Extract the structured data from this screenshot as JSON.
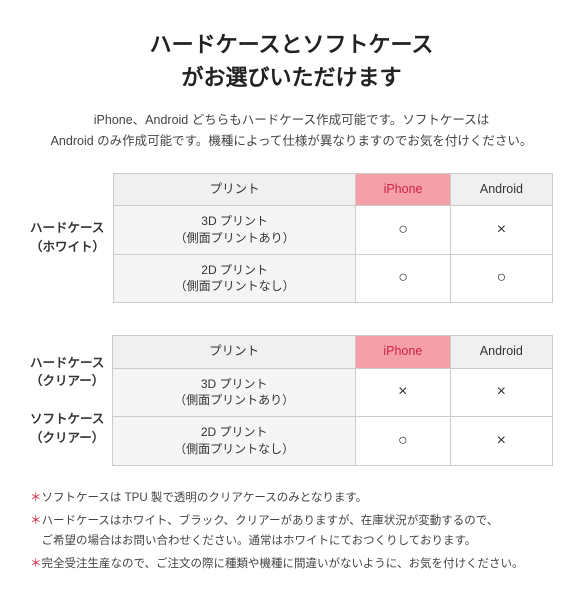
{
  "title": {
    "line1": "ハードケースとソフトケース",
    "line2": "がお選びいただけます"
  },
  "description": "iPhone、Android どちらもハードケース作成可能です。ソフトケースは\nAndroid のみ作成可能です。機種によって仕様が異なりますのでお気を付けください。",
  "table1": {
    "rowHeader": [
      "ハードケース",
      "（ホワイト）"
    ],
    "columns": [
      "プリント",
      "iPhone",
      "Android"
    ],
    "rows": [
      {
        "print": [
          "3D プリント",
          "（側面プリントあり）"
        ],
        "iphone": "○",
        "android": "×"
      },
      {
        "print": [
          "2D プリント",
          "（側面プリントなし）"
        ],
        "iphone": "○",
        "android": "○"
      }
    ]
  },
  "table2": {
    "rowHeader": [
      "ハードケース",
      "（クリアー）",
      "",
      "ソフトケース",
      "（クリアー）"
    ],
    "columns": [
      "プリント",
      "iPhone",
      "Android"
    ],
    "rows": [
      {
        "print": [
          "3D プリント",
          "（側面プリントあり）"
        ],
        "iphone": "×",
        "android": "×"
      },
      {
        "print": [
          "2D プリント",
          "（側面プリントなし）"
        ],
        "iphone": "○",
        "android": "×"
      }
    ]
  },
  "notes": [
    "＊ソフトケースは TPU 製で透明のクリアケースのみとなります。",
    "＊ハードケースはホワイト、ブラック、クリアーがありますが、在庫状況が変動するので、\nご希望の場合はお問い合わせください。通常はホワイトにておつくりしております。",
    "＊完全受注生産なので、ご注文の際に種類や機種に間違いがないように、お気を付けください。"
  ]
}
